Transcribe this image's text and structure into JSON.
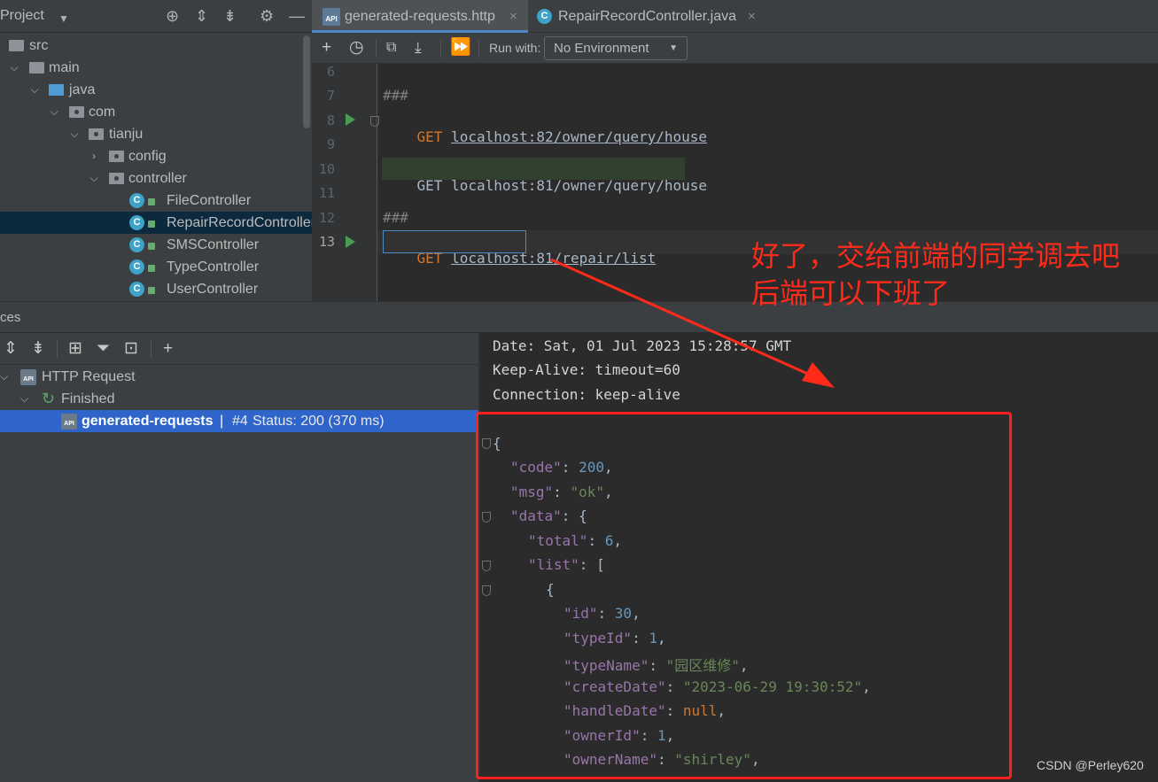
{
  "project_panel": {
    "title": "Project",
    "tree": [
      {
        "label": "src",
        "depth": 0,
        "icon": "folder-icon"
      },
      {
        "label": "main",
        "depth": 1,
        "icon": "folder-icon"
      },
      {
        "label": "java",
        "depth": 2,
        "icon": "source-folder-icon"
      },
      {
        "label": "com",
        "depth": 3,
        "icon": "package-icon"
      },
      {
        "label": "tianju",
        "depth": 4,
        "icon": "package-icon"
      },
      {
        "label": "config",
        "depth": 5,
        "icon": "package-icon"
      },
      {
        "label": "controller",
        "depth": 5,
        "icon": "package-icon"
      },
      {
        "label": "FileController",
        "depth": 6,
        "icon": "class-icon"
      },
      {
        "label": "RepairRecordController",
        "depth": 6,
        "icon": "class-icon"
      },
      {
        "label": "SMSController",
        "depth": 6,
        "icon": "class-icon"
      },
      {
        "label": "TypeController",
        "depth": 6,
        "icon": "class-icon"
      },
      {
        "label": "UserController",
        "depth": 6,
        "icon": "class-icon"
      }
    ]
  },
  "editor": {
    "tabs": [
      {
        "label": "generated-requests.http",
        "active": true,
        "close": "×"
      },
      {
        "label": "RepairRecordController.java",
        "active": false,
        "close": "×"
      }
    ],
    "toolbar": {
      "run_with_label": "Run with:",
      "environment": "No Environment"
    },
    "line_numbers": [
      "6",
      "7",
      "8",
      "9",
      "10",
      "11",
      "12",
      "13"
    ],
    "code": {
      "line7": "###",
      "line8_method": "GET",
      "line8_url": "localhost:82/owner/query/house",
      "line10_method": "GET",
      "line10_url": "localhost:81/owner/query/house",
      "line12": "###",
      "line13_method": "GET",
      "line13_host": "localhost:81",
      "line13_path": "/repair/list"
    }
  },
  "services": {
    "header_title": "ces",
    "tree": {
      "http_request": "HTTP Request",
      "finished": "Finished",
      "request_name": "generated-requests",
      "separator": "|",
      "request_number": "#4",
      "status": "Status: 200 (370 ms)"
    }
  },
  "response": {
    "headers": [
      "Date: Sat, 01 Jul 2023 15:28:57 GMT",
      "Keep-Alive: timeout=60",
      "Connection: keep-alive"
    ],
    "body": {
      "code": "200",
      "msg": "\"ok\"",
      "total": "6",
      "id": "30",
      "typeId": "1",
      "typeName": "\"园区维修\"",
      "createDate": "\"2023-06-29 19:30:52\"",
      "handleDate": "null",
      "ownerId": "1",
      "ownerName": "\"shirley\""
    }
  },
  "annotation": {
    "line1": "好了，交给前端的同学调去吧",
    "line2": "后端可以下班了",
    "color": "#ff2a1a"
  },
  "watermark": "CSDN @Perley620"
}
